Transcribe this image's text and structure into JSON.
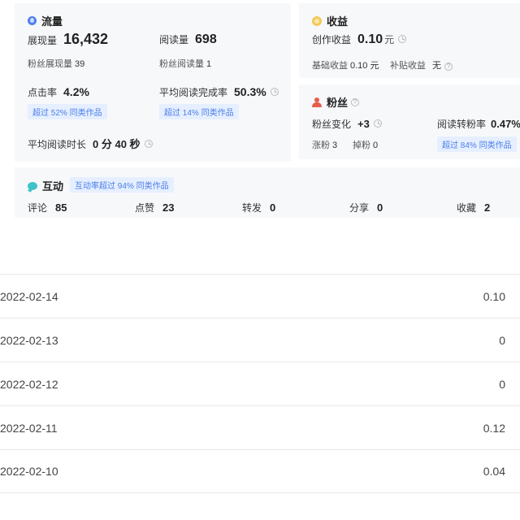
{
  "traffic": {
    "title": "流量",
    "impressions_label": "展现量",
    "impressions_value": "16,432",
    "reads_label": "阅读量",
    "reads_value": "698",
    "fan_impressions_label": "粉丝展现量",
    "fan_impressions_value": "39",
    "fan_reads_label": "粉丝阅读量",
    "fan_reads_value": "1",
    "ctr_label": "点击率",
    "ctr_value": "4.2%",
    "ctr_badge": "超过 52% 同类作品",
    "completion_label": "平均阅读完成率",
    "completion_value": "50.3%",
    "completion_badge": "超过 14% 同类作品",
    "duration_label": "平均阅读时长",
    "duration_value": "0 分 40 秒"
  },
  "income": {
    "title": "收益",
    "creation_label": "创作收益",
    "creation_value": "0.10",
    "creation_unit": "元",
    "base_label": "基础收益",
    "base_value": "0.10 元",
    "subsidy_label": "补贴收益",
    "subsidy_value": "无"
  },
  "fans": {
    "title": "粉丝",
    "change_label": "粉丝变化",
    "change_value": "+3",
    "conversion_label": "阅读转粉率",
    "conversion_value": "0.47%",
    "gain_label": "涨粉",
    "gain_value": "3",
    "loss_label": "掉粉",
    "loss_value": "0",
    "conversion_badge": "超过 84% 同类作品"
  },
  "interaction": {
    "title": "互动",
    "badge": "互动率超过 94% 同类作品",
    "stats": [
      {
        "label": "评论",
        "value": "85"
      },
      {
        "label": "点赞",
        "value": "23"
      },
      {
        "label": "转发",
        "value": "0"
      },
      {
        "label": "分享",
        "value": "0"
      },
      {
        "label": "收藏",
        "value": "2"
      }
    ]
  },
  "rows": [
    {
      "date": "2022-02-14",
      "amount": "0.10"
    },
    {
      "date": "2022-02-13",
      "amount": "0"
    },
    {
      "date": "2022-02-12",
      "amount": "0"
    },
    {
      "date": "2022-02-11",
      "amount": "0.12"
    },
    {
      "date": "2022-02-10",
      "amount": "0.04"
    }
  ]
}
